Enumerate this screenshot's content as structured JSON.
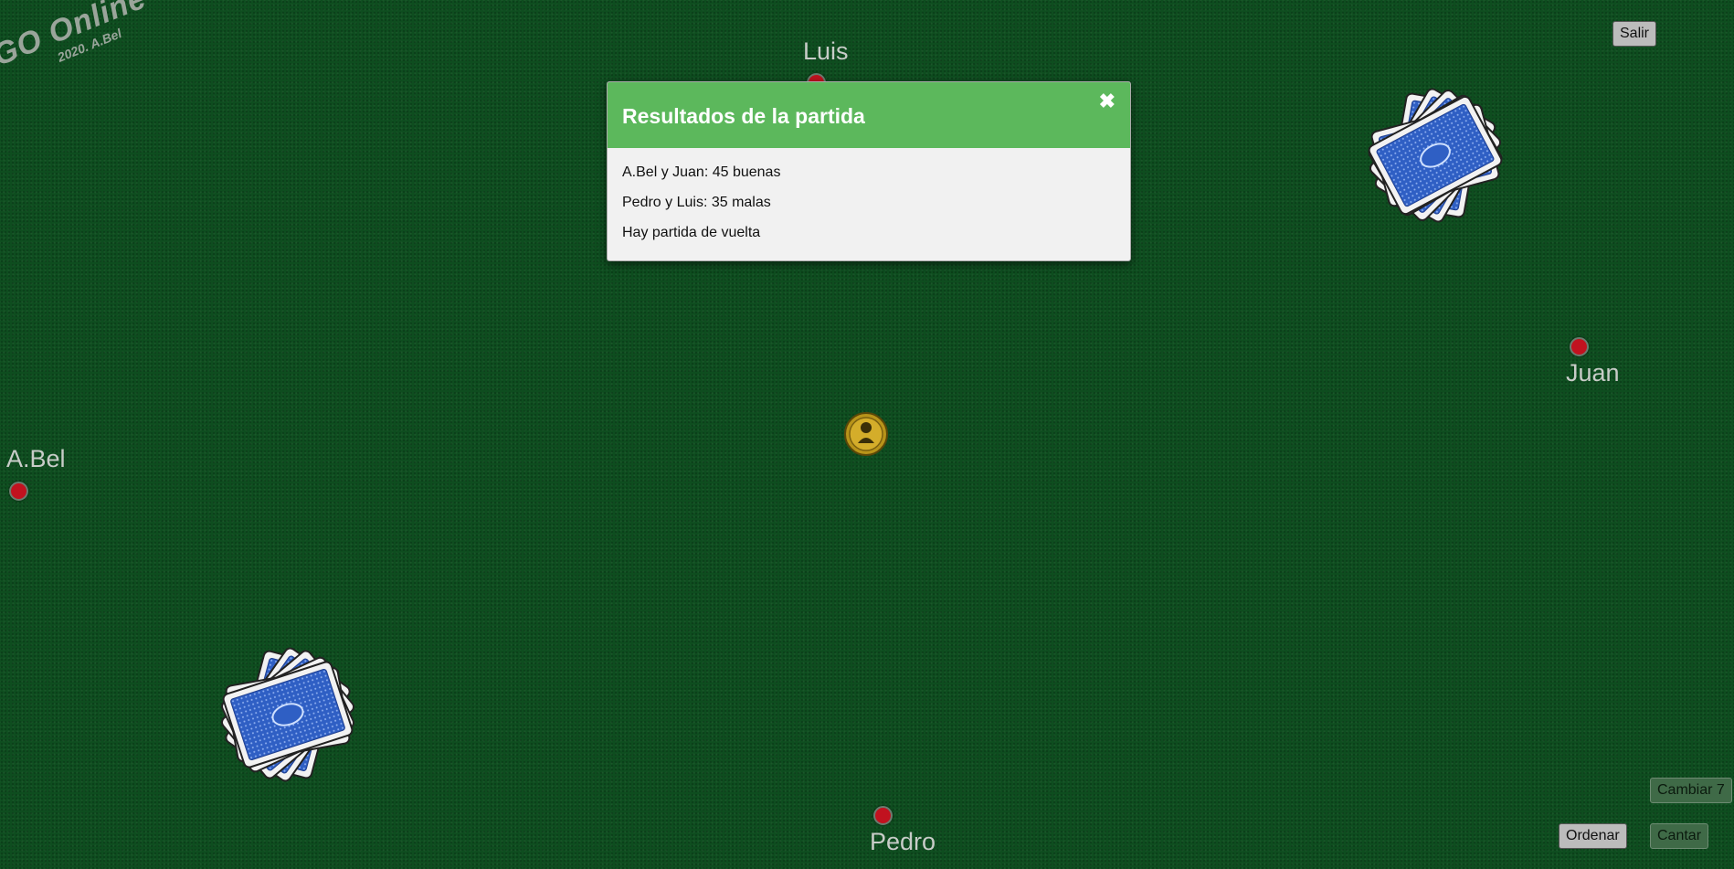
{
  "logo": {
    "title": "GO Online",
    "subtitle": "2020. A.Bel"
  },
  "buttons": {
    "exit": "Salir",
    "swap7": "Cambiar 7",
    "sort": "Ordenar",
    "sing": "Cantar"
  },
  "players": {
    "top": "Luis",
    "right": "Juan",
    "left": "A.Bel",
    "bottom": "Pedro"
  },
  "modal": {
    "title": "Resultados de la partida",
    "close_icon": "close-icon",
    "lines": [
      "A.Bel y Juan: 45 buenas",
      "Pedro y Luis: 35 malas",
      "Hay partida de vuelta"
    ]
  },
  "colors": {
    "table": "#0e4d1f",
    "modal_header": "#5cb85c",
    "player_dot": "#c1121f",
    "card_back": "#2f5fc4"
  }
}
